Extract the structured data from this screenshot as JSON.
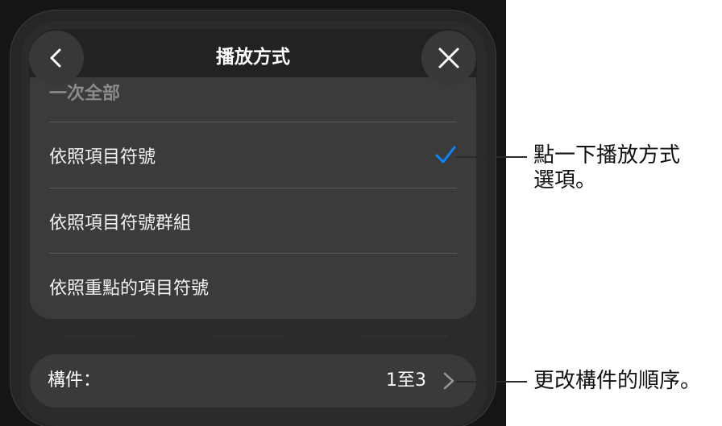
{
  "header": {
    "title": "播放方式"
  },
  "list": {
    "items": [
      {
        "label": "一次全部",
        "checked": false
      },
      {
        "label": "依照項目符號",
        "checked": true
      },
      {
        "label": "依照項目符號群組",
        "checked": false
      },
      {
        "label": "依照重點的項目符號",
        "checked": false
      }
    ]
  },
  "builds": {
    "label": "構件：",
    "value": "1至3"
  },
  "callouts": {
    "delivery_line1": "點一下播放方式",
    "delivery_line2": "選項。",
    "builds": "更改構件的順序。"
  },
  "colors": {
    "accent": "#0a84ff",
    "device_bg": "#151515",
    "list_bg": "#3b3b3b"
  },
  "icons": {
    "back": "chevron-left-icon",
    "close": "close-icon",
    "check": "checkmark-icon",
    "disclosure": "chevron-right-icon"
  }
}
